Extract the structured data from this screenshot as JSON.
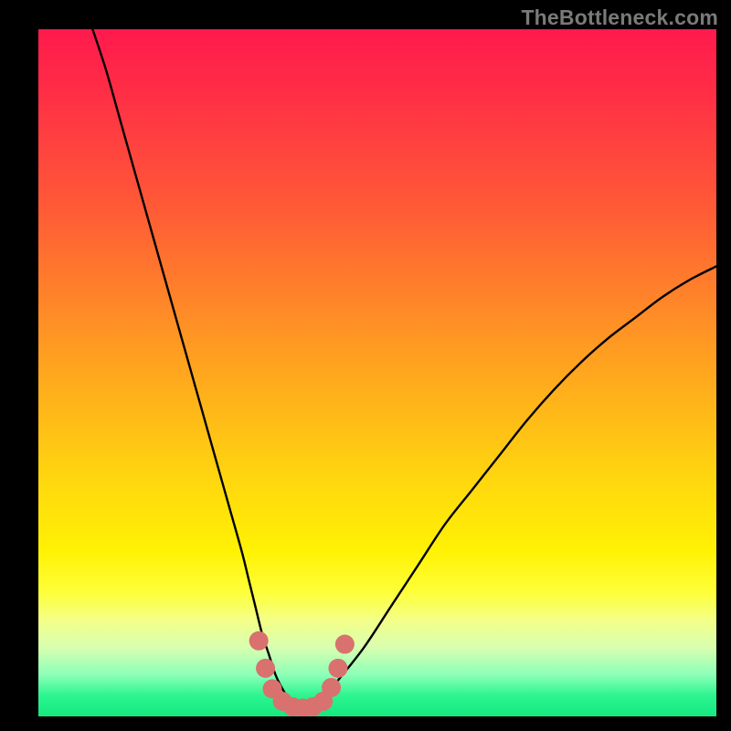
{
  "watermark": "TheBottleneck.com",
  "chart_data": {
    "type": "line",
    "title": "",
    "xlabel": "",
    "ylabel": "",
    "xlim": [
      0,
      100
    ],
    "ylim": [
      0,
      100
    ],
    "series": [
      {
        "name": "bottleneck-curve",
        "x": [
          8,
          10,
          12,
          14,
          16,
          18,
          20,
          22,
          24,
          26,
          28,
          30,
          31,
          32,
          33,
          34,
          35,
          36,
          37,
          38,
          39,
          40,
          41,
          42,
          44,
          48,
          52,
          56,
          60,
          64,
          68,
          72,
          76,
          80,
          84,
          88,
          92,
          96,
          100
        ],
        "y": [
          100,
          94,
          87,
          80,
          73,
          66,
          59,
          52,
          45,
          38,
          31,
          24,
          20,
          16,
          12,
          9,
          6,
          4,
          2.5,
          1.5,
          1,
          1,
          1.5,
          2.5,
          5,
          10,
          16,
          22,
          28,
          33,
          38,
          43,
          47.5,
          51.5,
          55,
          58,
          61,
          63.5,
          65.5
        ]
      }
    ],
    "markers": {
      "name": "highlight-dots",
      "points": [
        {
          "x": 32.5,
          "y": 11
        },
        {
          "x": 33.5,
          "y": 7
        },
        {
          "x": 34.5,
          "y": 4
        },
        {
          "x": 36,
          "y": 2.2
        },
        {
          "x": 37.5,
          "y": 1.4
        },
        {
          "x": 39,
          "y": 1.2
        },
        {
          "x": 40.5,
          "y": 1.4
        },
        {
          "x": 42,
          "y": 2.2
        },
        {
          "x": 43.2,
          "y": 4.2
        },
        {
          "x": 44.2,
          "y": 7
        },
        {
          "x": 45.2,
          "y": 10.5
        }
      ]
    }
  }
}
